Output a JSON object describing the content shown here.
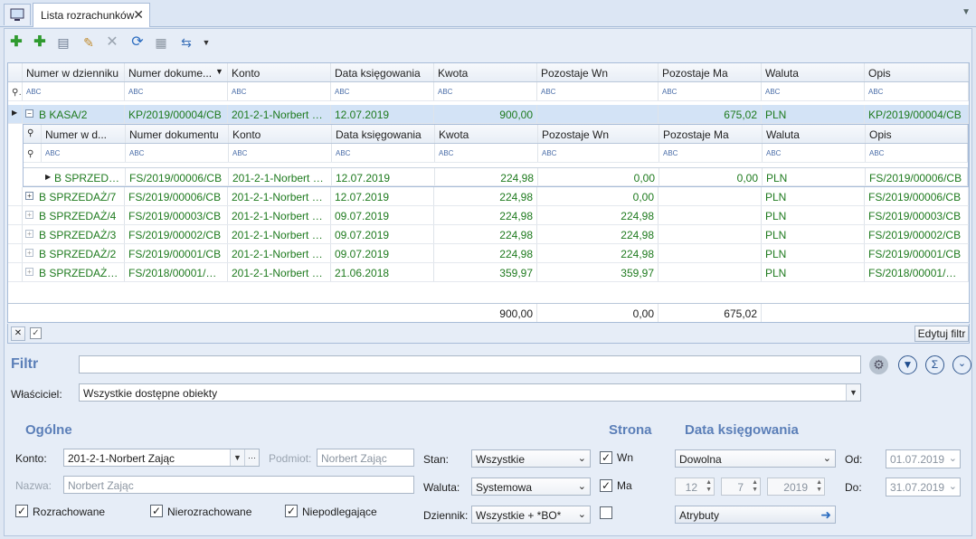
{
  "tab": {
    "title": "Lista rozrachunków",
    "close": "✕"
  },
  "toolbar": {
    "icons": [
      "add-icon",
      "add-alt-icon",
      "document-icon",
      "wrench-icon",
      "delete-icon",
      "refresh-icon",
      "print-icon",
      "export-icon"
    ]
  },
  "grid": {
    "columns": [
      "Numer w dzienniku",
      "Numer dokume...",
      "Konto",
      "Data księgowania",
      "Kwota",
      "Pozostaje Wn",
      "Pozostaje Ma",
      "Waluta",
      "Opis"
    ],
    "filter_placeholder": "ABC",
    "main_rows": [
      {
        "numer": "B KASA/2",
        "dokument": "KP/2019/00004/CB",
        "konto": "201-2-1-Norbert Za...",
        "data": "12.07.2019",
        "kwota": "900,00",
        "wn": "",
        "ma": "675,02",
        "waluta": "PLN",
        "opis": "KP/2019/00004/CB"
      },
      {
        "numer": "B SPRZEDAŻ/7",
        "dokument": "FS/2019/00006/CB",
        "konto": "201-2-1-Norbert Za...",
        "data": "12.07.2019",
        "kwota": "224,98",
        "wn": "0,00",
        "ma": "",
        "waluta": "PLN",
        "opis": "FS/2019/00006/CB"
      },
      {
        "numer": "B SPRZEDAŻ/4",
        "dokument": "FS/2019/00003/CB",
        "konto": "201-2-1-Norbert Za...",
        "data": "09.07.2019",
        "kwota": "224,98",
        "wn": "224,98",
        "ma": "",
        "waluta": "PLN",
        "opis": "FS/2019/00003/CB"
      },
      {
        "numer": "B SPRZEDAŻ/3",
        "dokument": "FS/2019/00002/CB",
        "konto": "201-2-1-Norbert Za...",
        "data": "09.07.2019",
        "kwota": "224,98",
        "wn": "224,98",
        "ma": "",
        "waluta": "PLN",
        "opis": "FS/2019/00002/CB"
      },
      {
        "numer": "B SPRZEDAŻ/2",
        "dokument": "FS/2019/00001/CB",
        "konto": "201-2-1-Norbert Za...",
        "data": "09.07.2019",
        "kwota": "224,98",
        "wn": "224,98",
        "ma": "",
        "waluta": "PLN",
        "opis": "FS/2019/00001/CB"
      },
      {
        "numer": "B SPRZEDAŻ/20...",
        "dokument": "FS/2018/00001/CB...",
        "konto": "201-2-1-Norbert Za...",
        "data": "21.06.2018",
        "kwota": "359,97",
        "wn": "359,97",
        "ma": "",
        "waluta": "PLN",
        "opis": "FS/2018/00001/CB_..."
      }
    ],
    "sub_columns": [
      "Numer w d...",
      "Numer dokumentu",
      "Konto",
      "Data księgowania",
      "Kwota",
      "Pozostaje Wn",
      "Pozostaje Ma",
      "Waluta",
      "Opis"
    ],
    "sub_row": {
      "numer": "B SPRZEDA...",
      "dokument": "FS/2019/00006/CB",
      "konto": "201-2-1-Norbert Za...",
      "data": "12.07.2019",
      "kwota": "224,98",
      "wn": "0,00",
      "ma": "0,00",
      "waluta": "PLN",
      "opis": "FS/2019/00006/CB"
    },
    "totals": {
      "kwota": "900,00",
      "wn": "0,00",
      "ma": "675,02"
    },
    "edit_filter": "Edytuj filtr"
  },
  "filter": {
    "label": "Filtr",
    "value": ""
  },
  "owner": {
    "label": "Właściciel:",
    "value": "Wszystkie dostępne obiekty"
  },
  "general": {
    "title": "Ogólne",
    "konto_label": "Konto:",
    "konto_value": "201-2-1-Norbert Zając",
    "podmiot_label": "Podmiot:",
    "podmiot_value": "Norbert Zając",
    "nazwa_label": "Nazwa:",
    "nazwa_value": "Norbert Zając",
    "chk_rozrachowane": "Rozrachowane",
    "chk_nierozrachowane": "Nierozrachowane",
    "chk_niepodlegajace": "Niepodlegające",
    "stan_label": "Stan:",
    "stan_value": "Wszystkie",
    "waluta_label": "Waluta:",
    "waluta_value": "Systemowa",
    "dziennik_label": "Dziennik:",
    "dziennik_value": "Wszystkie + *BO*"
  },
  "strona": {
    "title": "Strona",
    "wn": "Wn",
    "ma": "Ma"
  },
  "data_ksiegowania": {
    "title": "Data księgowania",
    "mode": "Dowolna",
    "day": "12",
    "month": "7",
    "year": "2019",
    "od_label": "Od:",
    "od_value": "01.07.2019",
    "do_label": "Do:",
    "do_value": "31.07.2019",
    "atrybuty": "Atrybuty"
  }
}
